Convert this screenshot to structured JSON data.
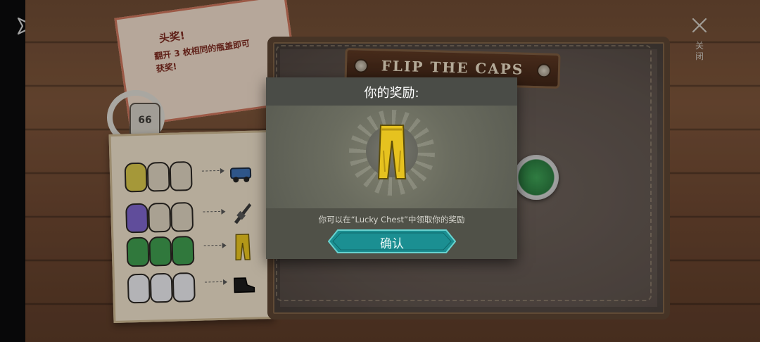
{
  "game": {
    "board_title": "FLIP THE CAPS",
    "close_label": "关闭"
  },
  "note": {
    "title": "头奖!",
    "lines": [
      "翻开 3 枚相同的瓶盖即可",
      "获奖!"
    ]
  },
  "ring": {
    "emblem_text": "66"
  },
  "legend": {
    "rows": [
      {
        "face_color": "#d4c34a",
        "prize": "vehicle-icon"
      },
      {
        "face_color": "#7b63c7",
        "prize": "rifle-icon"
      },
      {
        "face_color": "#3e9a4d",
        "prize": "pants-icon"
      },
      {
        "face_color": "#e6e6ea",
        "prize": "boots-icon"
      }
    ]
  },
  "dialog": {
    "title": "你的奖励:",
    "reward_icon": "yellow-pants-icon",
    "hint": "你可以在“Lucky Chest”中领取你的奖励",
    "confirm_label": "确认"
  },
  "colors": {
    "accent_teal": "#1e9ea0",
    "reward_yellow": "#e6c21f"
  }
}
